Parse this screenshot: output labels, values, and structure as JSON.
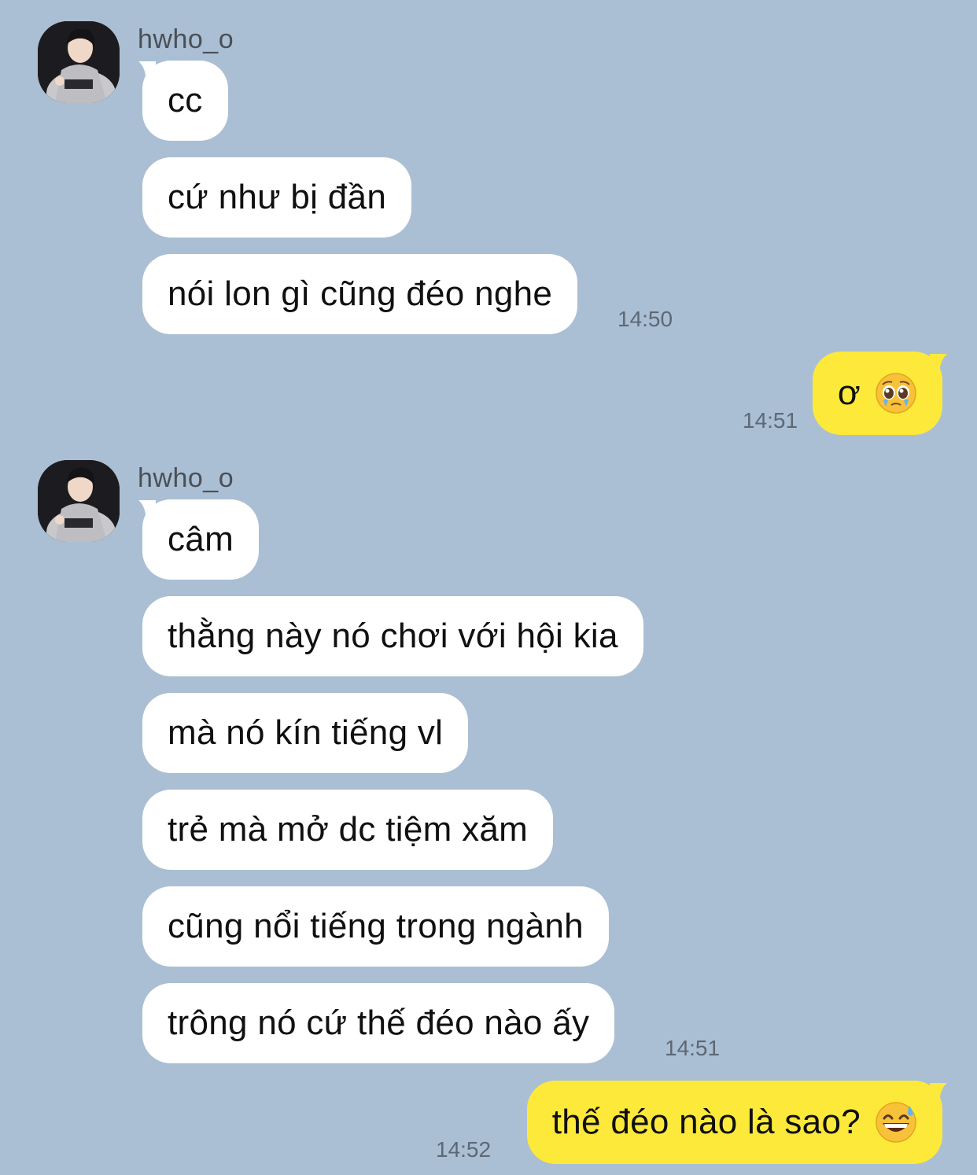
{
  "conversation": {
    "groups": [
      {
        "sender": "hwho_o",
        "time": "14:50",
        "messages": [
          "cc",
          "cứ như bị đần",
          "nói lon gì cũng đéo nghe"
        ]
      },
      {
        "time": "14:51",
        "message": "ơ",
        "emoji": "pleading-face-icon"
      },
      {
        "sender": "hwho_o",
        "time": "14:51",
        "messages": [
          "câm",
          "thằng này nó chơi với hội kia",
          "mà nó kín tiếng vl",
          "trẻ mà mở dc tiệm xăm",
          "cũng nổi tiếng trong ngành",
          "trông nó cứ thế đéo nào ấy"
        ]
      },
      {
        "time": "14:52",
        "message": "thế đéo nào là sao?",
        "emoji": "grinning-face-with-sweat-icon"
      }
    ]
  },
  "colors": {
    "background": "#aabfd3",
    "incoming_bubble": "#ffffff",
    "outgoing_bubble": "#fde93a",
    "timestamp": "#5d6876",
    "sender_name": "#4a4f57"
  }
}
